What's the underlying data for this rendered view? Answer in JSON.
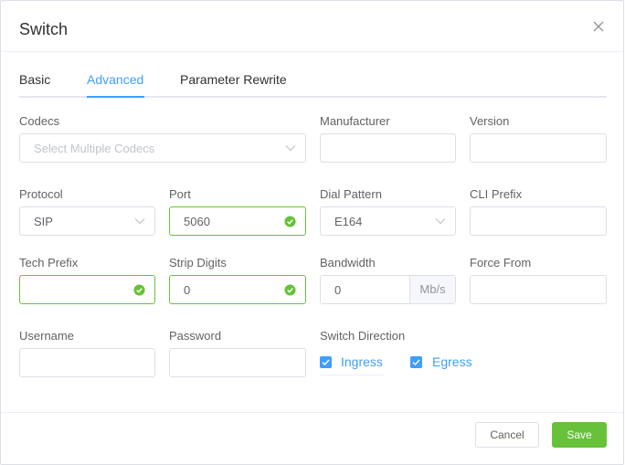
{
  "dialog": {
    "title": "Switch"
  },
  "tabs": [
    {
      "label": "Basic"
    },
    {
      "label": "Advanced",
      "active": true
    },
    {
      "label": "Parameter Rewrite"
    }
  ],
  "form": {
    "codecs": {
      "label": "Codecs",
      "placeholder": "Select Multiple Codecs",
      "value": ""
    },
    "manufacturer": {
      "label": "Manufacturer",
      "value": ""
    },
    "version": {
      "label": "Version",
      "value": ""
    },
    "protocol": {
      "label": "Protocol",
      "value": "SIP"
    },
    "port": {
      "label": "Port",
      "value": "5060",
      "valid": true
    },
    "dial_pattern": {
      "label": "Dial Pattern",
      "value": "E164"
    },
    "cli_prefix": {
      "label": "CLI Prefix",
      "value": ""
    },
    "tech_prefix": {
      "label": "Tech Prefix",
      "value": "",
      "valid": true
    },
    "strip_digits": {
      "label": "Strip Digits",
      "value": "0",
      "valid": true
    },
    "bandwidth": {
      "label": "Bandwidth",
      "value": "0",
      "unit": "Mb/s"
    },
    "force_from": {
      "label": "Force From",
      "value": ""
    },
    "username": {
      "label": "Username",
      "value": ""
    },
    "password": {
      "label": "Password",
      "value": ""
    },
    "switch_direction": {
      "label": "Switch Direction",
      "options": [
        {
          "label": "Ingress",
          "checked": true
        },
        {
          "label": "Egress",
          "checked": true
        }
      ]
    }
  },
  "footer": {
    "cancel_label": "Cancel",
    "save_label": "Save"
  },
  "colors": {
    "primary": "#409eff",
    "success": "#67c23a",
    "border": "#dcdfe6"
  },
  "icons": {
    "close": "close-icon",
    "dropdown": "chevron-down-icon",
    "valid": "check-circle-icon",
    "checkbox": "checkbox-checked-icon"
  }
}
